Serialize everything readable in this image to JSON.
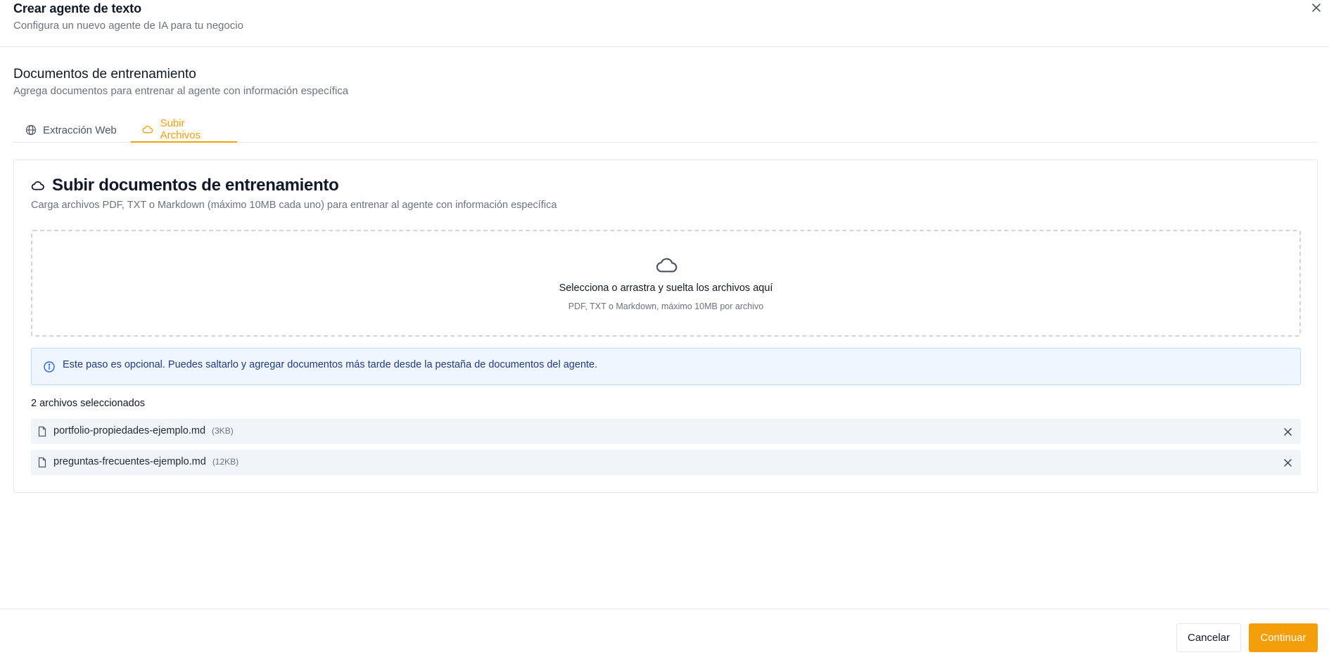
{
  "modal": {
    "title": "Crear agente de texto",
    "subtitle": "Configura un nuevo agente de IA para tu negocio",
    "close_icon": "close-icon"
  },
  "section": {
    "title": "Documentos de entrenamiento",
    "description": "Agrega documentos para entrenar al agente con información específica"
  },
  "tabs": [
    {
      "label": "Extracción Web",
      "icon": "globe-icon",
      "active": false
    },
    {
      "label": "Subir Archivos",
      "icon": "cloud-icon",
      "active": true
    }
  ],
  "upload_card": {
    "title": "Subir documentos de entrenamiento",
    "title_icon": "cloud-icon",
    "description": "Carga archivos PDF, TXT o Markdown (máximo 10MB cada uno) para entrenar al agente con información específica",
    "dropzone": {
      "icon": "cloud-icon",
      "main_text": "Selecciona o arrastra y suelta los archivos aquí",
      "sub_text": "PDF, TXT o Markdown, máximo 10MB por archivo"
    },
    "info": {
      "icon": "info-icon",
      "text": "Este paso es opcional. Puedes saltarlo y agregar documentos más tarde desde la pestaña de documentos del agente."
    },
    "files_count_label": "2 archivos seleccionados",
    "files": [
      {
        "name": "portfolio-propiedades-ejemplo.md",
        "size": "(3KB)",
        "icon": "file-icon"
      },
      {
        "name": "preguntas-frecuentes-ejemplo.md",
        "size": "(12KB)",
        "icon": "file-icon"
      }
    ]
  },
  "footer": {
    "cancel_label": "Cancelar",
    "continue_label": "Continuar"
  },
  "colors": {
    "accent": "#f59e0b",
    "info_bg": "#eff6ff",
    "info_text": "#1e3a8a",
    "muted_text": "#6b7280",
    "file_row_bg": "#f1f5f9"
  }
}
